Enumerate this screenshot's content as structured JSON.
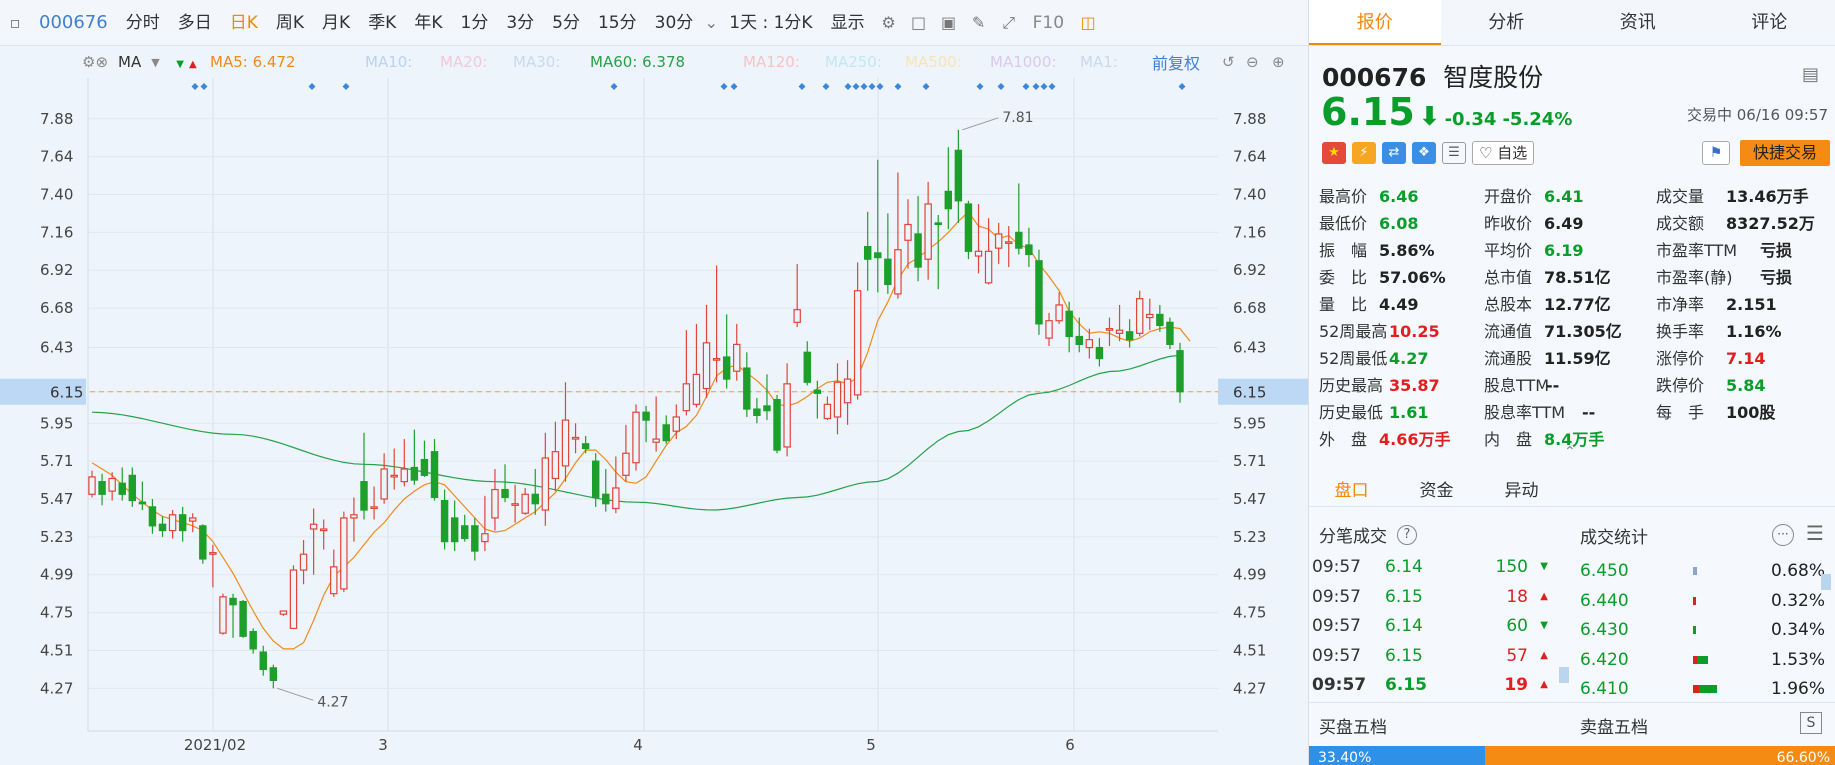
{
  "toolbar": {
    "code": "000676",
    "items": [
      "分时",
      "多日",
      "日K",
      "周K",
      "月K",
      "季K",
      "年K",
      "1分",
      "3分",
      "5分",
      "15分",
      "30分"
    ],
    "active": "日K",
    "range_select": "1天 : 1分K",
    "display_select": "显示",
    "f10": "F10"
  },
  "ma_bar": {
    "type": "MA",
    "items": [
      {
        "label": "MA5: 6.472",
        "color": "#f08a1a",
        "arrow": "down"
      },
      {
        "label": "MA10:",
        "color": "#b9d3f0"
      },
      {
        "label": "MA20:",
        "color": "#f2c8da"
      },
      {
        "label": "MA30:",
        "color": "#c9d9ee"
      },
      {
        "label": "MA60: 6.378",
        "color": "#27a14a",
        "arrow": "up"
      },
      {
        "label": "MA120:",
        "color": "#f4c4c4"
      },
      {
        "label": "MA250:",
        "color": "#bfe8f2"
      },
      {
        "label": "MA500:",
        "color": "#f6e4b8"
      },
      {
        "label": "MA1000:",
        "color": "#d8c9ee"
      },
      {
        "label": "MA1:",
        "color": "#c9d9ee"
      }
    ],
    "adjust": "前复权"
  },
  "chart_data": {
    "type": "candlestick",
    "y_ticks": [
      "7.88",
      "7.64",
      "7.40",
      "7.16",
      "6.92",
      "6.68",
      "6.43",
      "6.15",
      "5.95",
      "5.71",
      "5.47",
      "5.23",
      "4.99",
      "4.75",
      "4.51",
      "4.27"
    ],
    "x_labels": [
      "2021/02",
      "3",
      "4",
      "5",
      "6"
    ],
    "ylim": [
      4.12,
      7.98
    ],
    "current_price": "6.15",
    "high_label": "7.81",
    "low_label": "4.27",
    "candles": [
      [
        5.5,
        5.61,
        5.48,
        5.65
      ],
      [
        5.58,
        5.5,
        5.43,
        5.63
      ],
      [
        5.52,
        5.6,
        5.46,
        5.64
      ],
      [
        5.57,
        5.5,
        5.46,
        5.67
      ],
      [
        5.62,
        5.46,
        5.42,
        5.67
      ],
      [
        5.45,
        5.44,
        5.4,
        5.58
      ],
      [
        5.42,
        5.3,
        5.25,
        5.47
      ],
      [
        5.31,
        5.27,
        5.23,
        5.36
      ],
      [
        5.27,
        5.37,
        5.22,
        5.4
      ],
      [
        5.37,
        5.27,
        5.2,
        5.42
      ],
      [
        5.33,
        5.35,
        5.26,
        5.38
      ],
      [
        5.3,
        5.09,
        5.06,
        5.31
      ],
      [
        5.12,
        5.13,
        4.91,
        5.18
      ],
      [
        4.62,
        4.85,
        4.61,
        4.87
      ],
      [
        4.84,
        4.8,
        4.59,
        4.87
      ],
      [
        4.82,
        4.6,
        4.59,
        4.83
      ],
      [
        4.63,
        4.52,
        4.49,
        4.65
      ],
      [
        4.5,
        4.39,
        4.35,
        4.54
      ],
      [
        4.4,
        4.32,
        4.27,
        4.42
      ],
      [
        4.74,
        4.76,
        4.73,
        4.76
      ],
      [
        4.65,
        5.02,
        4.66,
        5.05
      ],
      [
        5.02,
        5.12,
        4.93,
        5.21
      ],
      [
        5.28,
        5.31,
        4.99,
        5.41
      ],
      [
        5.27,
        5.28,
        5.15,
        5.34
      ],
      [
        4.87,
        5.04,
        4.85,
        5.15
      ],
      [
        4.9,
        5.35,
        4.88,
        5.39
      ],
      [
        5.35,
        5.37,
        5.2,
        5.48
      ],
      [
        5.58,
        5.4,
        5.34,
        5.89
      ],
      [
        5.42,
        5.42,
        5.34,
        5.55
      ],
      [
        5.47,
        5.66,
        5.44,
        5.76
      ],
      [
        5.61,
        5.62,
        5.53,
        5.79
      ],
      [
        5.58,
        5.66,
        5.55,
        5.85
      ],
      [
        5.67,
        5.59,
        5.56,
        5.91
      ],
      [
        5.72,
        5.62,
        5.61,
        5.84
      ],
      [
        5.77,
        5.48,
        5.46,
        5.85
      ],
      [
        5.46,
        5.2,
        5.15,
        5.53
      ],
      [
        5.35,
        5.2,
        5.14,
        5.46
      ],
      [
        5.3,
        5.22,
        5.2,
        5.37
      ],
      [
        5.3,
        5.14,
        5.08,
        5.35
      ],
      [
        5.2,
        5.25,
        5.14,
        5.49
      ],
      [
        5.35,
        5.53,
        5.27,
        5.66
      ],
      [
        5.53,
        5.48,
        5.45,
        5.69
      ],
      [
        5.43,
        5.44,
        5.32,
        5.56
      ],
      [
        5.38,
        5.5,
        5.37,
        5.54
      ],
      [
        5.5,
        5.44,
        5.37,
        5.66
      ],
      [
        5.4,
        5.73,
        5.3,
        5.89
      ],
      [
        5.6,
        5.77,
        5.52,
        5.96
      ],
      [
        5.68,
        5.97,
        5.58,
        6.21
      ],
      [
        5.85,
        5.86,
        5.76,
        5.95
      ],
      [
        5.82,
        5.79,
        5.76,
        5.87
      ],
      [
        5.71,
        5.48,
        5.42,
        5.76
      ],
      [
        5.5,
        5.44,
        5.39,
        5.66
      ],
      [
        5.41,
        5.54,
        5.38,
        5.74
      ],
      [
        5.62,
        5.76,
        5.58,
        5.94
      ],
      [
        5.7,
        6.02,
        5.65,
        6.07
      ],
      [
        6.02,
        5.97,
        5.83,
        6.06
      ],
      [
        5.83,
        5.85,
        5.77,
        6.12
      ],
      [
        5.94,
        5.84,
        5.82,
        6.0
      ],
      [
        5.9,
        5.99,
        5.85,
        6.07
      ],
      [
        6.03,
        6.2,
        6.0,
        6.54
      ],
      [
        6.07,
        6.26,
        6.05,
        6.58
      ],
      [
        6.17,
        6.46,
        6.11,
        6.7
      ],
      [
        6.35,
        6.36,
        6.21,
        6.95
      ],
      [
        6.37,
        6.23,
        6.17,
        6.64
      ],
      [
        6.28,
        6.45,
        6.22,
        6.58
      ],
      [
        6.3,
        6.04,
        5.99,
        6.4
      ],
      [
        6.04,
        6.0,
        5.95,
        6.11
      ],
      [
        6.06,
        6.03,
        5.97,
        6.26
      ],
      [
        6.1,
        5.78,
        5.76,
        6.13
      ],
      [
        5.8,
        6.2,
        5.74,
        6.33
      ],
      [
        6.59,
        6.67,
        6.56,
        6.96
      ],
      [
        6.4,
        6.21,
        6.19,
        6.47
      ],
      [
        6.16,
        6.14,
        5.98,
        6.22
      ],
      [
        5.98,
        6.07,
        5.97,
        6.12
      ],
      [
        5.99,
        6.21,
        5.88,
        6.33
      ],
      [
        6.08,
        6.23,
        5.94,
        6.35
      ],
      [
        6.13,
        6.79,
        6.1,
        6.97
      ],
      [
        7.07,
        6.99,
        6.79,
        7.29
      ],
      [
        7.03,
        7.0,
        6.78,
        7.62
      ],
      [
        6.99,
        6.83,
        6.77,
        7.28
      ],
      [
        6.77,
        7.05,
        6.74,
        7.54
      ],
      [
        7.11,
        7.21,
        6.93,
        7.37
      ],
      [
        7.15,
        6.94,
        6.85,
        7.39
      ],
      [
        6.99,
        7.34,
        6.86,
        7.48
      ],
      [
        7.22,
        7.21,
        6.8,
        7.27
      ],
      [
        7.42,
        7.31,
        7.18,
        7.7
      ],
      [
        7.68,
        7.36,
        7.22,
        7.81
      ],
      [
        7.34,
        7.04,
        6.99,
        7.36
      ],
      [
        7.01,
        7.04,
        6.9,
        7.34
      ],
      [
        6.84,
        7.04,
        6.83,
        7.25
      ],
      [
        7.06,
        7.15,
        6.96,
        7.22
      ],
      [
        7.1,
        7.1,
        6.94,
        7.2
      ],
      [
        7.16,
        7.06,
        7.02,
        7.47
      ],
      [
        7.08,
        7.02,
        6.94,
        7.19
      ],
      [
        6.98,
        6.58,
        6.51,
        7.05
      ],
      [
        6.49,
        6.6,
        6.44,
        6.65
      ],
      [
        6.6,
        6.7,
        6.58,
        6.78
      ],
      [
        6.66,
        6.5,
        6.4,
        6.72
      ],
      [
        6.5,
        6.45,
        6.4,
        6.62
      ],
      [
        6.43,
        6.48,
        6.36,
        6.55
      ],
      [
        6.43,
        6.36,
        6.31,
        6.49
      ],
      [
        6.54,
        6.55,
        6.44,
        6.62
      ],
      [
        6.52,
        6.54,
        6.47,
        6.7
      ],
      [
        6.53,
        6.48,
        6.43,
        6.61
      ],
      [
        6.52,
        6.74,
        6.5,
        6.79
      ],
      [
        6.62,
        6.64,
        6.54,
        6.74
      ],
      [
        6.64,
        6.57,
        6.53,
        6.7
      ],
      [
        6.59,
        6.45,
        6.42,
        6.62
      ],
      [
        6.41,
        6.15,
        6.08,
        6.46
      ]
    ],
    "ma5": [
      5.7,
      5.66,
      5.62,
      5.56,
      5.5,
      5.45,
      5.4,
      5.36,
      5.34,
      5.32,
      5.3,
      5.27,
      5.2,
      5.1,
      5.0,
      4.88,
      4.76,
      4.65,
      4.57,
      4.52,
      4.52,
      4.56,
      4.7,
      4.86,
      4.98,
      5.04,
      5.1,
      5.18,
      5.26,
      5.32,
      5.4,
      5.47,
      5.52,
      5.56,
      5.58,
      5.56,
      5.49,
      5.42,
      5.35,
      5.28,
      5.26,
      5.27,
      5.31,
      5.35,
      5.39,
      5.45,
      5.51,
      5.6,
      5.7,
      5.78,
      5.78,
      5.72,
      5.64,
      5.58,
      5.57,
      5.61,
      5.71,
      5.81,
      5.89,
      5.93,
      6.0,
      6.12,
      6.25,
      6.3,
      6.32,
      6.27,
      6.22,
      6.16,
      6.07,
      6.06,
      6.08,
      6.12,
      6.17,
      6.21,
      6.22,
      6.2,
      6.24,
      6.4,
      6.6,
      6.72,
      6.86,
      6.96,
      7.0,
      7.05,
      7.1,
      7.16,
      7.23,
      7.29,
      7.2,
      7.18,
      7.12,
      7.14,
      7.08,
      7.06,
      6.96,
      6.88,
      6.79,
      6.66,
      6.58,
      6.52,
      6.53,
      6.52,
      6.49,
      6.47,
      6.49,
      6.53,
      6.55,
      6.56,
      6.55,
      6.47
    ]
  },
  "quote_tabs": [
    "报价",
    "分析",
    "资讯",
    "评论"
  ],
  "stock": {
    "code": "000676",
    "name": "智度股份",
    "price": "6.15",
    "change": "-0.34",
    "pct": "-5.24%",
    "status": "交易中 06/16 09:57",
    "watch_label": "自选",
    "trade_label": "快捷交易"
  },
  "quote_rows": [
    [
      {
        "k": "最高价",
        "v": "6.46",
        "c": "green"
      },
      {
        "k": "开盘价",
        "v": "6.41",
        "c": "green"
      },
      {
        "k": "成交量",
        "v": "13.46万手",
        "c": "black"
      }
    ],
    [
      {
        "k": "最低价",
        "v": "6.08",
        "c": "green"
      },
      {
        "k": "昨收价",
        "v": "6.49",
        "c": "black"
      },
      {
        "k": "成交额",
        "v": "8327.52万",
        "c": "black"
      }
    ],
    [
      {
        "k": "振　幅",
        "v": "5.86%",
        "c": "black"
      },
      {
        "k": "平均价",
        "v": "6.19",
        "c": "green"
      },
      {
        "k": "市盈率TTM",
        "v": "亏损",
        "c": "black"
      }
    ],
    [
      {
        "k": "委　比",
        "v": "57.06%",
        "c": "black"
      },
      {
        "k": "总市值",
        "v": "78.51亿",
        "c": "black"
      },
      {
        "k": "市盈率(静)",
        "v": "亏损",
        "c": "black"
      }
    ],
    [
      {
        "k": "量　比",
        "v": "4.49",
        "c": "black"
      },
      {
        "k": "总股本",
        "v": "12.77亿",
        "c": "black"
      },
      {
        "k": "市净率",
        "v": "2.151",
        "c": "black"
      }
    ],
    [
      {
        "k": "52周最高",
        "v": "10.25",
        "c": "red"
      },
      {
        "k": "流通值",
        "v": "71.305亿",
        "c": "black"
      },
      {
        "k": "换手率",
        "v": "1.16%",
        "c": "black"
      }
    ],
    [
      {
        "k": "52周最低",
        "v": "4.27",
        "c": "green"
      },
      {
        "k": "流通股",
        "v": "11.59亿",
        "c": "black"
      },
      {
        "k": "涨停价",
        "v": "7.14",
        "c": "red"
      }
    ],
    [
      {
        "k": "历史最高",
        "v": "35.87",
        "c": "red"
      },
      {
        "k": "股息TTM",
        "v": "--",
        "c": "black"
      },
      {
        "k": "跌停价",
        "v": "5.84",
        "c": "green"
      }
    ],
    [
      {
        "k": "历史最低",
        "v": "1.61",
        "c": "green"
      },
      {
        "k": "股息率TTM",
        "v": "--",
        "c": "black"
      },
      {
        "k": "每　手",
        "v": "100股",
        "c": "black"
      }
    ],
    [
      {
        "k": "外　盘",
        "v": "4.66万手",
        "c": "red"
      },
      {
        "k": "内　盘",
        "v": "8.4万手",
        "c": "green"
      },
      {
        "k": "",
        "v": "",
        "c": "black"
      }
    ]
  ],
  "sub_tabs": [
    "盘口",
    "资金",
    "异动"
  ],
  "trades_title": "分笔成交",
  "stats_title": "成交统计",
  "trades": [
    {
      "t": "09:57",
      "p": "6.14",
      "pc": "green",
      "v": "150",
      "vc": "green",
      "dir": "down"
    },
    {
      "t": "09:57",
      "p": "6.15",
      "pc": "green",
      "v": "18",
      "vc": "red",
      "dir": "up"
    },
    {
      "t": "09:57",
      "p": "6.14",
      "pc": "green",
      "v": "60",
      "vc": "green",
      "dir": "down"
    },
    {
      "t": "09:57",
      "p": "6.15",
      "pc": "green",
      "v": "57",
      "vc": "red",
      "dir": "up"
    },
    {
      "t": "09:57",
      "p": "6.15",
      "pc": "green",
      "v": "19",
      "vc": "red",
      "dir": "up"
    }
  ],
  "stats": [
    {
      "p": "6.450",
      "pct": "0.68%",
      "frac": 0.04,
      "mix": "blue"
    },
    {
      "p": "6.440",
      "pct": "0.32%",
      "frac": 0.02,
      "mix": "red"
    },
    {
      "p": "6.430",
      "pct": "0.34%",
      "frac": 0.02,
      "mix": "green"
    },
    {
      "p": "6.420",
      "pct": "1.53%",
      "frac": 0.14,
      "mix": "both"
    },
    {
      "p": "6.410",
      "pct": "1.96%",
      "frac": 0.22,
      "mix": "both"
    }
  ],
  "buy_label": "买盘五档",
  "sell_label": "卖盘五档",
  "buy_pct": "33.40%",
  "sell_pct": "66.60%",
  "buy_frac": 0.334
}
